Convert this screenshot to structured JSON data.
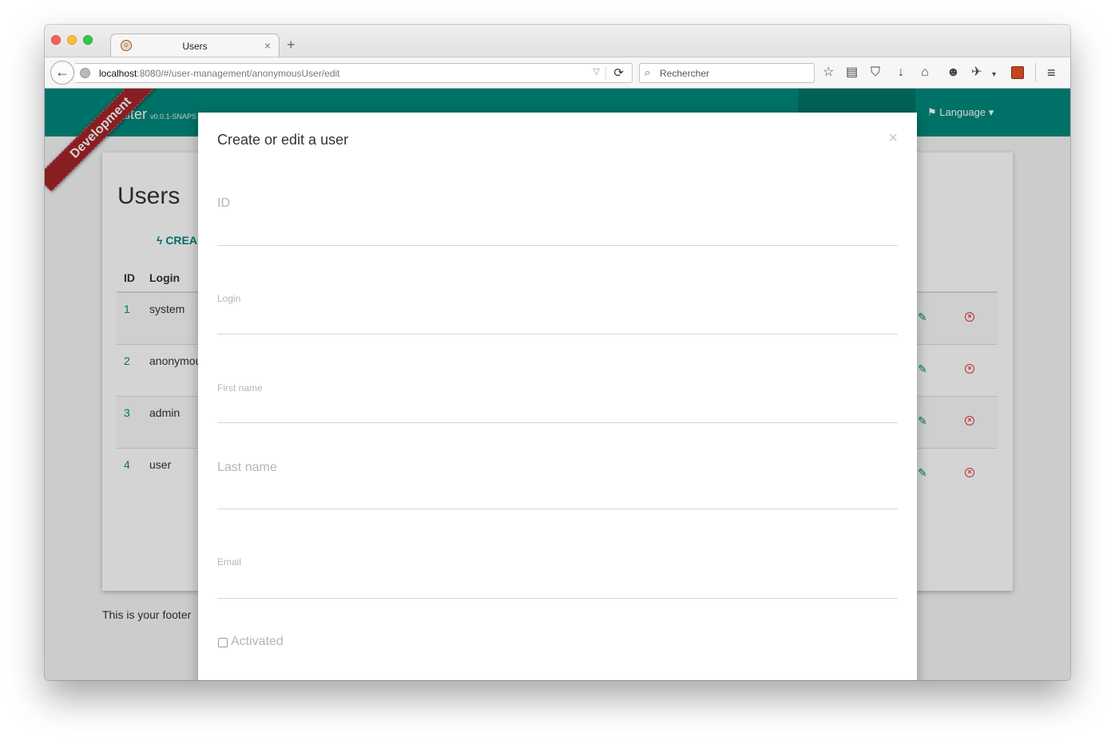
{
  "browser": {
    "tab_title": "Users",
    "tab_close": "×",
    "new_tab": "+",
    "url_host": "localhost",
    "url_rest": ":8080/#/user-management/anonymousUser/edit",
    "search_placeholder": "Rechercher",
    "icons": {
      "back": "←",
      "reload": "⟳",
      "search": "⚲",
      "bookmark": "☆",
      "reader": "▤",
      "pocket": "⛉",
      "download": "↓",
      "home": "⌂",
      "chat": "☻",
      "menu": "≡"
    }
  },
  "app": {
    "brand": "ster",
    "version": "v0.0.1-SNAPS",
    "ribbon": "Development",
    "nav_language": "Language ▾"
  },
  "users_page": {
    "title": "Users",
    "create_label": "CREA",
    "headers": {
      "id": "ID",
      "login": "Login"
    },
    "rows": [
      {
        "id": "1",
        "login": "system"
      },
      {
        "id": "2",
        "login": "anonymou"
      },
      {
        "id": "3",
        "login": "admin"
      },
      {
        "id": "4",
        "login": "user"
      }
    ],
    "edit_icon": "✎",
    "delete_icon": "×",
    "footer": "This is your footer"
  },
  "modal": {
    "title": "Create or edit a user",
    "close": "×",
    "fields": {
      "id_label": "ID",
      "login_label": "Login",
      "first_name_label": "First name",
      "last_name_label": "Last name",
      "email_label": "Email"
    },
    "activated_label": "Activated"
  }
}
